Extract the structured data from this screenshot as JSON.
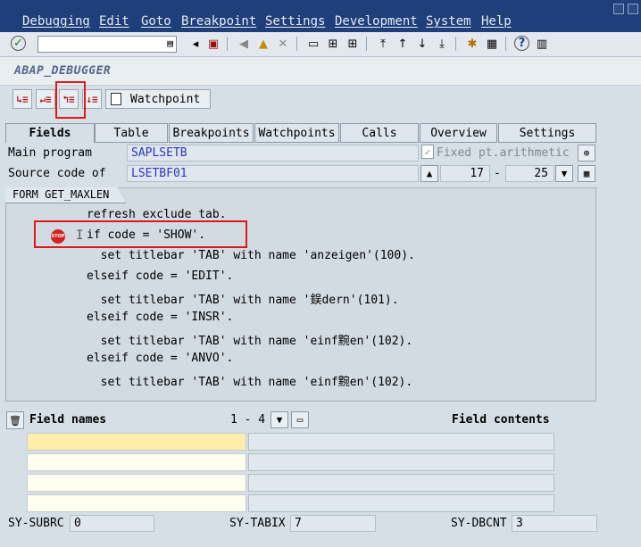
{
  "menu": [
    "Debugging",
    "Edit",
    "Goto",
    "Breakpoint",
    "Settings",
    "Development",
    "System",
    "Help"
  ],
  "window": {
    "title": "ABAP_DEBUGGER"
  },
  "app_toolbar": {
    "watchpoint_label": "Watchpoint"
  },
  "tabs": [
    "Fields",
    "Table",
    "Breakpoints",
    "Watchpoints",
    "Calls",
    "Overview",
    "Settings"
  ],
  "program": {
    "main_label": "Main program",
    "main_value": "SAPLSETB",
    "source_label": "Source code of",
    "source_value": "LSETBF01",
    "fixed_label": "Fixed pt.arithmetic",
    "line_from": "17",
    "dash": "-",
    "line_to": "25"
  },
  "source": {
    "form_label": "FORM GET_MAXLEN",
    "lines": [
      "refresh exclude tab.",
      "if code = 'SHOW'.",
      "  set titlebar 'TAB' with name 'anzeigen'(100).",
      "elseif code = 'EDIT'.",
      "  set titlebar 'TAB' with name '鋘dern'(101).",
      "elseif code = 'INSR'.",
      "  set titlebar 'TAB' with name 'einf黦en'(102).",
      "elseif code = 'ANVO'.",
      "  set titlebar 'TAB' with name 'einf黦en'(102)."
    ],
    "stop_icon_text": "STOP",
    "cursor_glyph": "I"
  },
  "fields": {
    "names_label": "Field names",
    "range": "1 - 4",
    "contents_label": "Field contents"
  },
  "sysfields": [
    {
      "label": "SY-SUBRC",
      "value": "0"
    },
    {
      "label": "SY-TABIX",
      "value": "7"
    },
    {
      "label": "SY-DBCNT",
      "value": "3"
    }
  ],
  "colors": {
    "menubar": "#1f3f7a",
    "highlight": "#e01818",
    "field_value": "#2a34c8"
  }
}
